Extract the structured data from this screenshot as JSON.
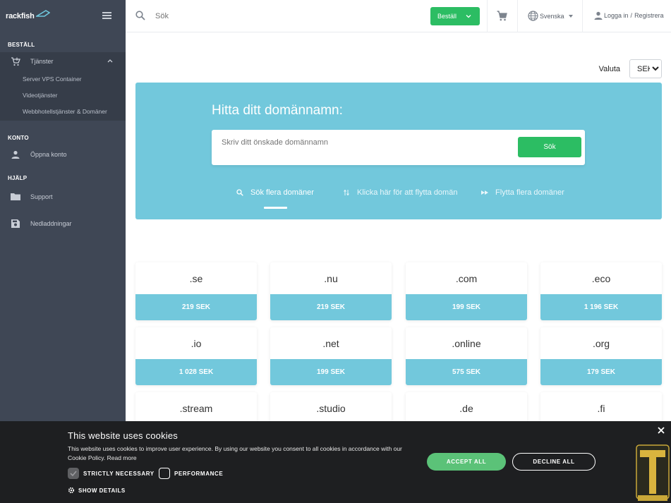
{
  "sidebar": {
    "logo_text": "rackfish",
    "sections": {
      "order": "BESTÄLL",
      "account": "KONTO",
      "help": "HJÄLP"
    },
    "services_label": "Tjänster",
    "sub_items": [
      "Server VPS Container",
      "Videotjänster",
      "Webbhotellstjänster & Domäner"
    ],
    "open_account": "Öppna konto",
    "support": "Support",
    "downloads": "Nedladdningar"
  },
  "topbar": {
    "search_placeholder": "Sök",
    "order_label": "Beställ",
    "language": "Svenska",
    "login": "Logga in",
    "separator": "/",
    "register": "Registrera"
  },
  "currency": {
    "label": "Valuta",
    "selected": "SEK"
  },
  "hero": {
    "title": "Hitta ditt domännamn:",
    "input_placeholder": "Skriv ditt önskade domännamn",
    "search_button": "Sök",
    "tabs": [
      {
        "label": "Sök flera domäner",
        "active": true
      },
      {
        "label": "Klicka här för att flytta domän",
        "active": false
      },
      {
        "label": "Flytta flera domäner",
        "active": false
      }
    ]
  },
  "domains": [
    {
      "tld": ".se",
      "price": "219 SEK"
    },
    {
      "tld": ".nu",
      "price": "219 SEK"
    },
    {
      "tld": ".com",
      "price": "199 SEK"
    },
    {
      "tld": ".eco",
      "price": "1 196 SEK"
    },
    {
      "tld": ".io",
      "price": "1 028 SEK"
    },
    {
      "tld": ".net",
      "price": "199 SEK"
    },
    {
      "tld": ".online",
      "price": "575 SEK"
    },
    {
      "tld": ".org",
      "price": "179 SEK"
    },
    {
      "tld": ".stream",
      "price": ""
    },
    {
      "tld": ".studio",
      "price": ""
    },
    {
      "tld": ".de",
      "price": ""
    },
    {
      "tld": ".fi",
      "price": ""
    }
  ],
  "cookie": {
    "title": "This website uses cookies",
    "text": "This website uses cookies to improve user experience. By using our website you consent to all cookies in accordance with our Cookie Policy.",
    "read_more": "Read more",
    "strictly_necessary": "STRICTLY NECESSARY",
    "performance": "PERFORMANCE",
    "show_details": "SHOW DETAILS",
    "accept_all": "ACCEPT ALL",
    "decline_all": "DECLINE ALL"
  },
  "colors": {
    "sidebar_bg": "#3f4755",
    "accent_green": "#2cbd63",
    "hero_blue": "#72c8dc",
    "cookie_bg": "#1e1f21"
  }
}
